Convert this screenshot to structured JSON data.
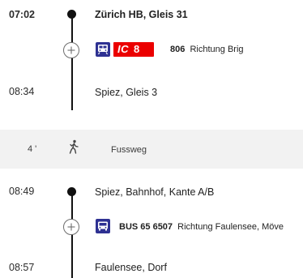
{
  "leg1": {
    "dep_time": "07:02",
    "dep_stop": "Zürich HB, Gleis 31",
    "product_label": "IC",
    "line": "8",
    "train_number": "806",
    "direction": "Richtung Brig",
    "arr_time": "08:34",
    "arr_stop": "Spiez, Gleis 3"
  },
  "transfer": {
    "duration": "4 '",
    "mode": "Fussweg"
  },
  "leg2": {
    "dep_time": "08:49",
    "dep_stop": "Spiez, Bahnhof, Kante A/B",
    "line_label": "BUS 65 6507",
    "direction": "Richtung Faulensee, Möve",
    "arr_time": "08:57",
    "arr_stop": "Faulensee, Dorf"
  },
  "icons": {
    "expand": "plus-circle-icon",
    "train": "train-icon",
    "walk": "walking-person-icon",
    "bus": "bus-icon"
  },
  "colors": {
    "ic_red": "#eb0000",
    "transport_blue": "#2e3192",
    "transfer_background": "#f2f2f2"
  }
}
